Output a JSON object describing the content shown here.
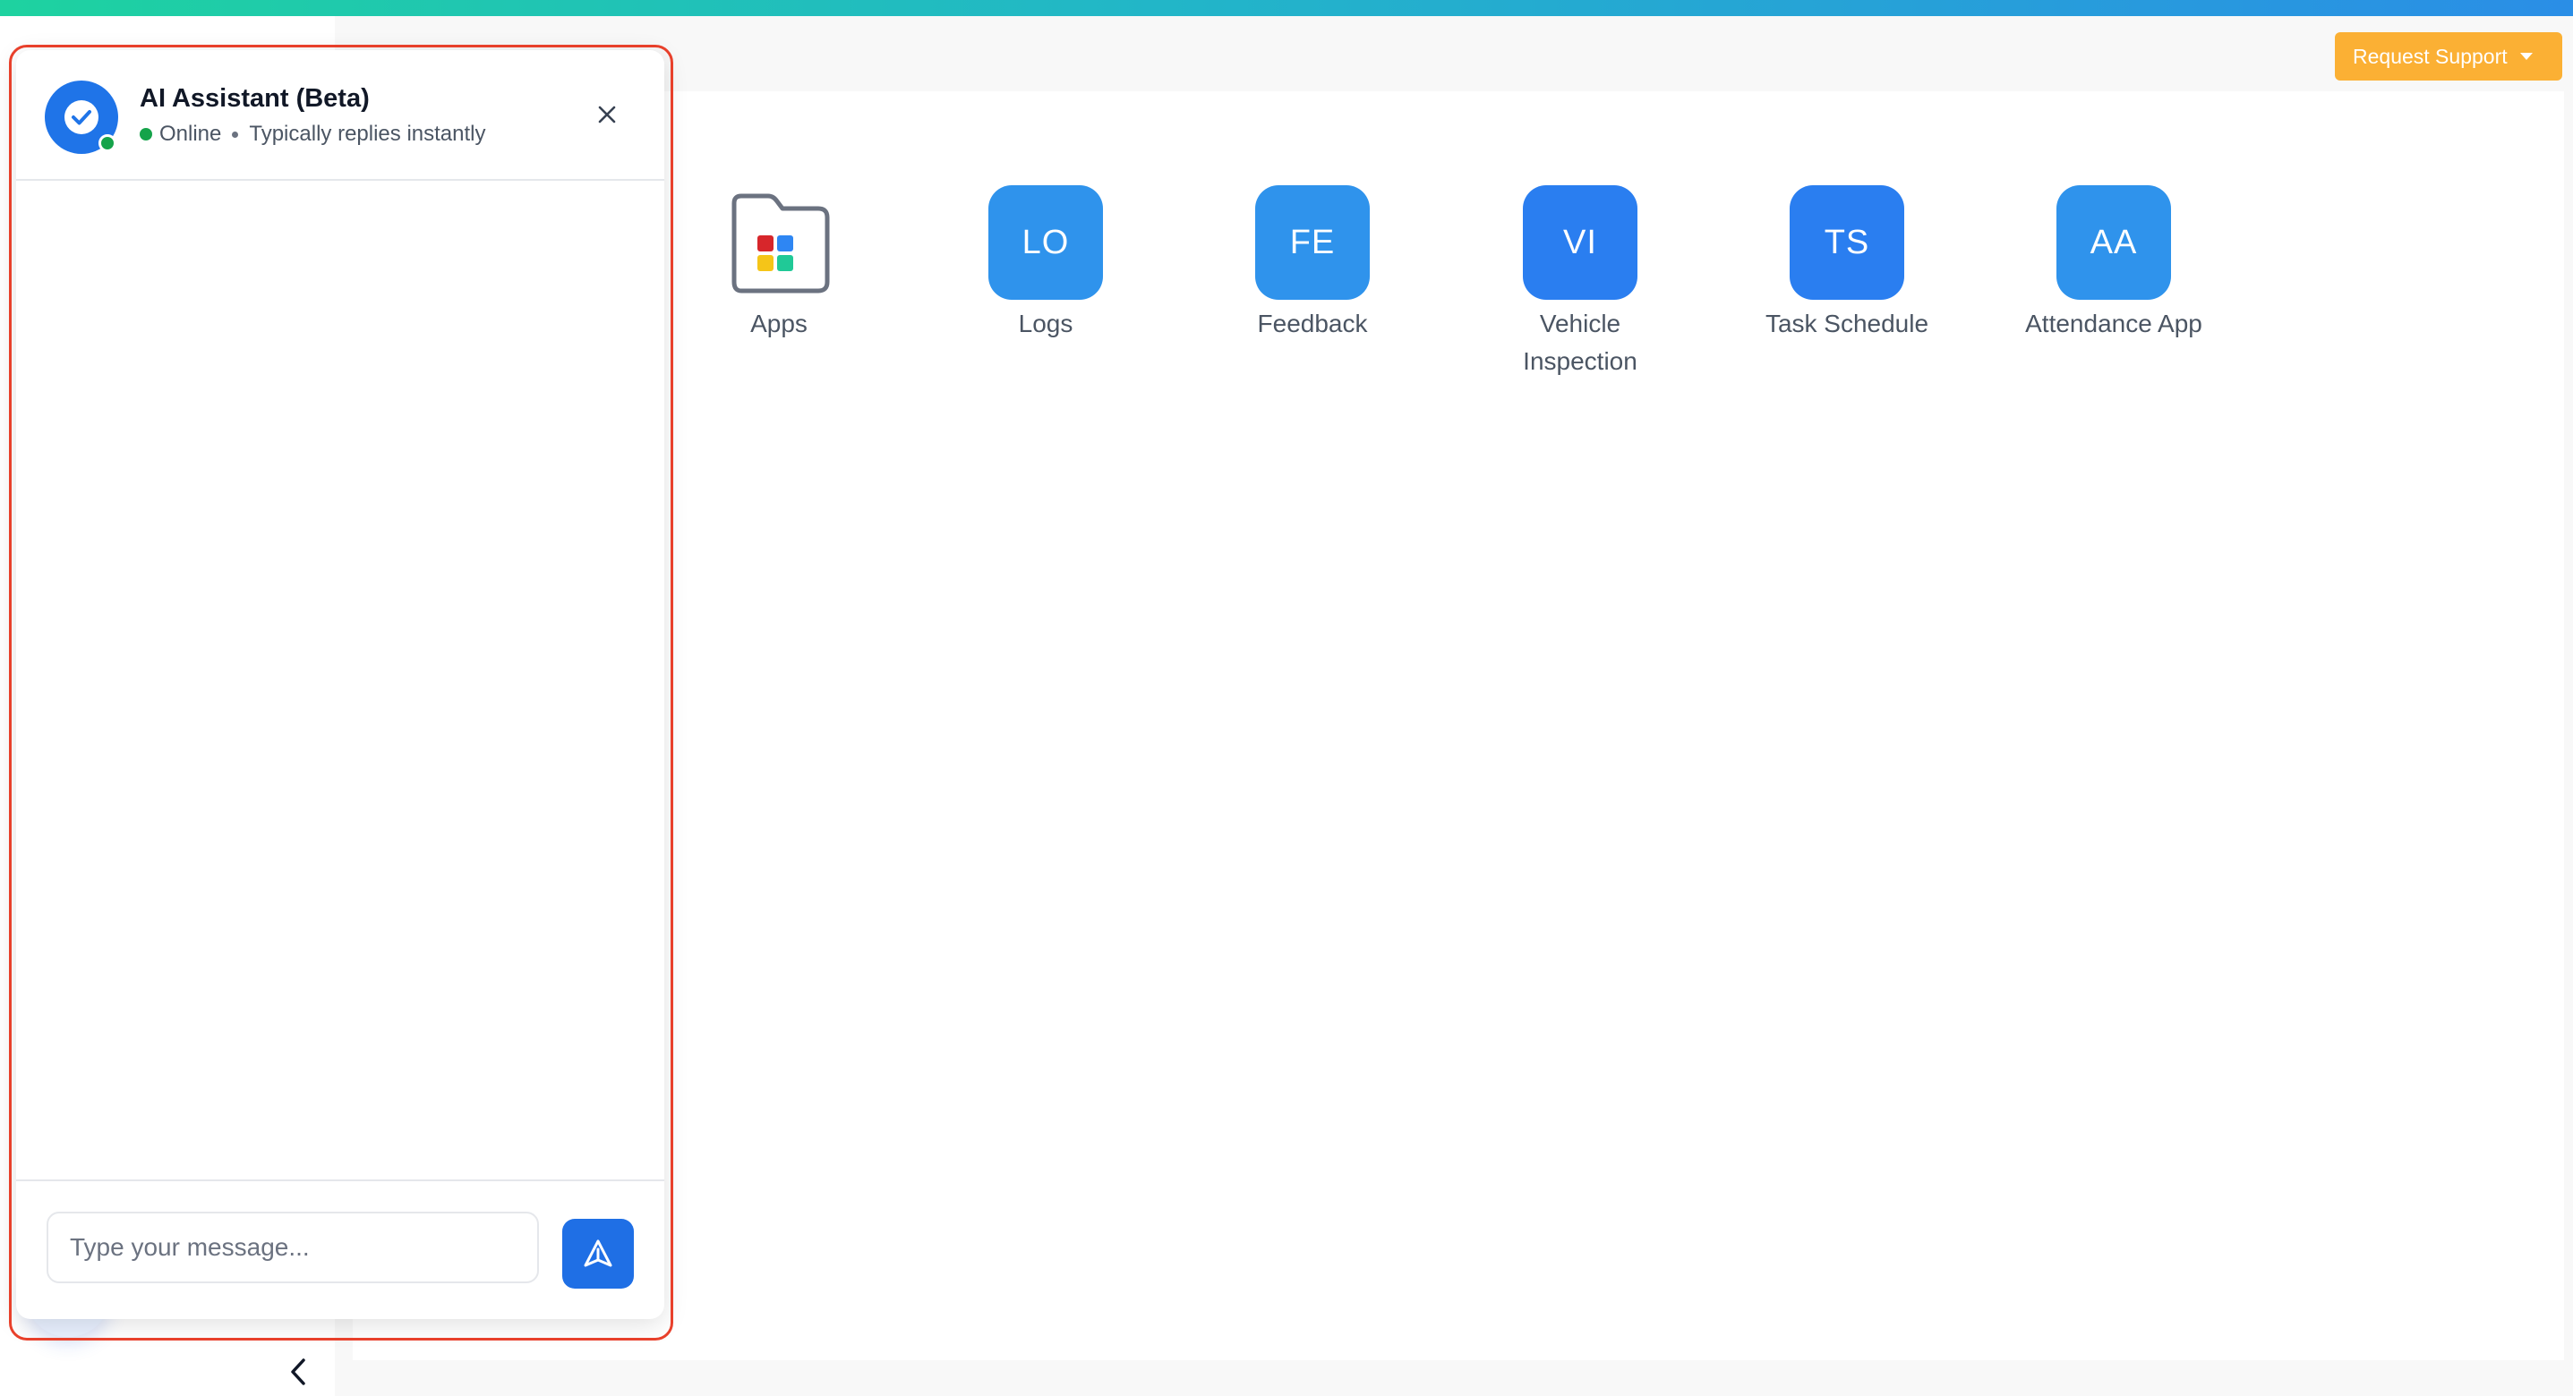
{
  "header": {
    "support_button_label": "Request Support"
  },
  "apps": [
    {
      "label": "Apps",
      "type": "folder",
      "colors": [
        "#d7262b",
        "#2e86f3",
        "#f5c518",
        "#20c997"
      ]
    },
    {
      "label": "Logs",
      "initials": "LO",
      "color": "#2f93ec"
    },
    {
      "label": "Feedback",
      "initials": "FE",
      "color": "#2f93ec"
    },
    {
      "label": "Vehicle Inspection",
      "initials": "VI",
      "color": "#2a7ef0"
    },
    {
      "label": "Task Schedule",
      "initials": "TS",
      "color": "#2a7ef0"
    },
    {
      "label": "Attendance App",
      "initials": "AA",
      "color": "#2f93ec"
    }
  ],
  "chat": {
    "title": "AI Assistant (Beta)",
    "status": "Online",
    "status_detail": "Typically replies instantly",
    "input_placeholder": "Type your message...",
    "input_value": ""
  },
  "icons": {
    "close": "close-icon",
    "send": "send-icon",
    "collapse": "chevron-left-icon",
    "assistant": "check-circle-icon"
  }
}
